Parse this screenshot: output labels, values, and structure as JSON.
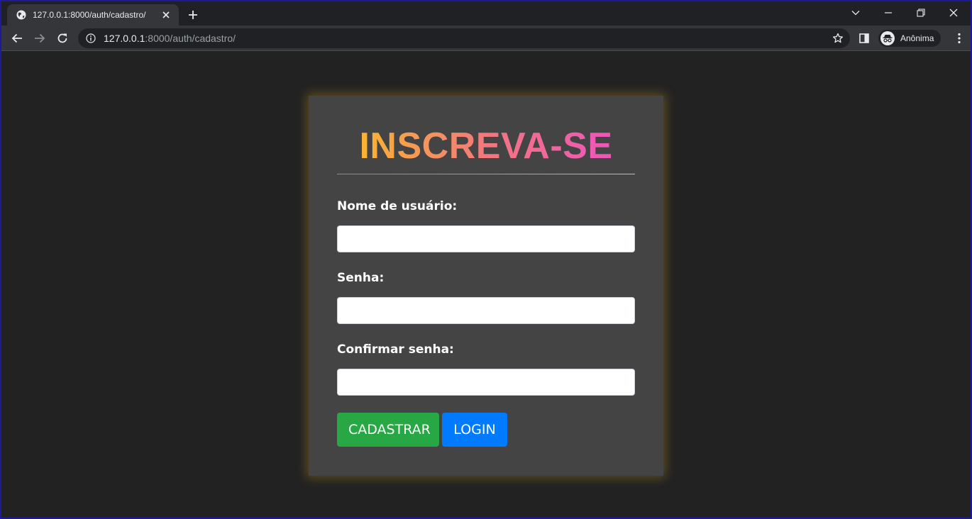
{
  "browser": {
    "tab": {
      "title": "127.0.0.1:8000/auth/cadastro/",
      "favicon": "globe-icon"
    },
    "address_bar": {
      "host": "127.0.0.1",
      "path": ":8000/auth/cadastro/"
    },
    "profile": {
      "label": "Anônima",
      "icon": "incognito-icon"
    },
    "colors": {
      "tabstrip": "#202124",
      "toolbar": "#35363a",
      "omnibox": "#202124"
    }
  },
  "form": {
    "title": "INSCREVA-SE",
    "fields": [
      {
        "label": "Nome de usuário:",
        "value": "",
        "placeholder": ""
      },
      {
        "label": "Senha:",
        "value": "",
        "placeholder": ""
      },
      {
        "label": "Confirmar senha:",
        "value": "",
        "placeholder": ""
      }
    ],
    "buttons": {
      "register": "CADASTRAR",
      "login": "LOGIN"
    },
    "colors": {
      "page_bg": "#222222",
      "card_bg": "#444444",
      "title_gradient": [
        "#fbbf24",
        "#f2787e",
        "#ec4fc4"
      ],
      "register_button": "#28a745",
      "login_button": "#007bff"
    }
  }
}
